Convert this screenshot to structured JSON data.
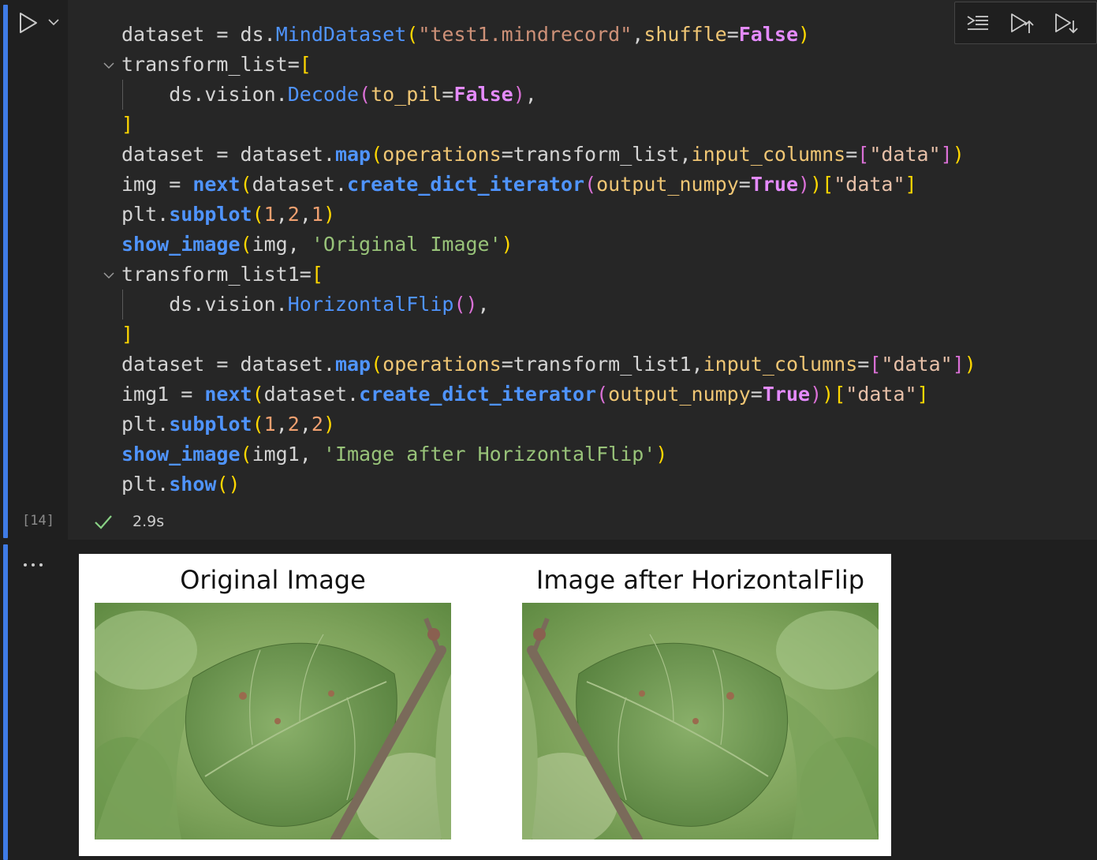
{
  "cell": {
    "execution_count": "[14]",
    "duration": "2.9s",
    "code_lines": [
      [
        [
          "t-var",
          "dataset "
        ],
        [
          "t-op",
          "= "
        ],
        [
          "t-var",
          "ds."
        ],
        [
          "t-cls",
          "MindDataset"
        ],
        [
          "t-br1",
          "("
        ],
        [
          "t-str",
          "\"test1.mindrecord\""
        ],
        [
          "t-op",
          ","
        ],
        [
          "t-prm",
          "shuffle"
        ],
        [
          "t-op",
          "="
        ],
        [
          "t-kw",
          "False"
        ],
        [
          "t-br1",
          ")"
        ]
      ],
      [
        [
          "t-var",
          "transform_list"
        ],
        [
          "t-op",
          "="
        ],
        [
          "t-br1",
          "["
        ]
      ],
      [
        [
          "t-var",
          "    ds.vision."
        ],
        [
          "t-cls",
          "Decode"
        ],
        [
          "t-br2",
          "("
        ],
        [
          "t-prm",
          "to_pil"
        ],
        [
          "t-op",
          "="
        ],
        [
          "t-kw",
          "False"
        ],
        [
          "t-br2",
          ")"
        ],
        [
          "t-op",
          ","
        ]
      ],
      [
        [
          "t-br1",
          "]"
        ]
      ],
      [
        [
          "t-var",
          "dataset "
        ],
        [
          "t-op",
          "= "
        ],
        [
          "t-var",
          "dataset."
        ],
        [
          "t-fn",
          "map"
        ],
        [
          "t-br1",
          "("
        ],
        [
          "t-prm",
          "operations"
        ],
        [
          "t-op",
          "="
        ],
        [
          "t-var",
          "transform_list"
        ],
        [
          "t-op",
          ","
        ],
        [
          "t-prm",
          "input_columns"
        ],
        [
          "t-op",
          "="
        ],
        [
          "t-br2",
          "["
        ],
        [
          "t-str2",
          "\"data\""
        ],
        [
          "t-br2",
          "]"
        ],
        [
          "t-br1",
          ")"
        ]
      ],
      [
        [
          "t-var",
          "img "
        ],
        [
          "t-op",
          "= "
        ],
        [
          "t-fn",
          "next"
        ],
        [
          "t-br1",
          "("
        ],
        [
          "t-var",
          "dataset."
        ],
        [
          "t-fn",
          "create_dict_iterator"
        ],
        [
          "t-br2",
          "("
        ],
        [
          "t-prm",
          "output_numpy"
        ],
        [
          "t-op",
          "="
        ],
        [
          "t-kw",
          "True"
        ],
        [
          "t-br2",
          ")"
        ],
        [
          "t-br1",
          ")"
        ],
        [
          "t-br1",
          "["
        ],
        [
          "t-str2",
          "\"data\""
        ],
        [
          "t-br1",
          "]"
        ]
      ],
      [
        [
          "t-var",
          "plt."
        ],
        [
          "t-fn",
          "subplot"
        ],
        [
          "t-br1",
          "("
        ],
        [
          "t-num",
          "1"
        ],
        [
          "t-op",
          ","
        ],
        [
          "t-num",
          "2"
        ],
        [
          "t-op",
          ","
        ],
        [
          "t-num",
          "1"
        ],
        [
          "t-br1",
          ")"
        ]
      ],
      [
        [
          "t-fn",
          "show_image"
        ],
        [
          "t-br1",
          "("
        ],
        [
          "t-var",
          "img"
        ],
        [
          "t-op",
          ", "
        ],
        [
          "t-strg",
          "'Original Image'"
        ],
        [
          "t-br1",
          ")"
        ]
      ],
      [
        [
          "t-var",
          "transform_list1"
        ],
        [
          "t-op",
          "="
        ],
        [
          "t-br1",
          "["
        ]
      ],
      [
        [
          "t-var",
          "    ds.vision."
        ],
        [
          "t-cls",
          "HorizontalFlip"
        ],
        [
          "t-br2",
          "()"
        ],
        [
          "t-op",
          ","
        ]
      ],
      [
        [
          "t-br1",
          "]"
        ]
      ],
      [
        [
          "t-var",
          "dataset "
        ],
        [
          "t-op",
          "= "
        ],
        [
          "t-var",
          "dataset."
        ],
        [
          "t-fn",
          "map"
        ],
        [
          "t-br1",
          "("
        ],
        [
          "t-prm",
          "operations"
        ],
        [
          "t-op",
          "="
        ],
        [
          "t-var",
          "transform_list1"
        ],
        [
          "t-op",
          ","
        ],
        [
          "t-prm",
          "input_columns"
        ],
        [
          "t-op",
          "="
        ],
        [
          "t-br2",
          "["
        ],
        [
          "t-str2",
          "\"data\""
        ],
        [
          "t-br2",
          "]"
        ],
        [
          "t-br1",
          ")"
        ]
      ],
      [
        [
          "t-var",
          "img1 "
        ],
        [
          "t-op",
          "= "
        ],
        [
          "t-fn",
          "next"
        ],
        [
          "t-br1",
          "("
        ],
        [
          "t-var",
          "dataset."
        ],
        [
          "t-fn",
          "create_dict_iterator"
        ],
        [
          "t-br2",
          "("
        ],
        [
          "t-prm",
          "output_numpy"
        ],
        [
          "t-op",
          "="
        ],
        [
          "t-kw",
          "True"
        ],
        [
          "t-br2",
          ")"
        ],
        [
          "t-br1",
          ")"
        ],
        [
          "t-br1",
          "["
        ],
        [
          "t-str2",
          "\"data\""
        ],
        [
          "t-br1",
          "]"
        ]
      ],
      [
        [
          "t-var",
          "plt."
        ],
        [
          "t-fn",
          "subplot"
        ],
        [
          "t-br1",
          "("
        ],
        [
          "t-num",
          "1"
        ],
        [
          "t-op",
          ","
        ],
        [
          "t-num",
          "2"
        ],
        [
          "t-op",
          ","
        ],
        [
          "t-num",
          "2"
        ],
        [
          "t-br1",
          ")"
        ]
      ],
      [
        [
          "t-fn",
          "show_image"
        ],
        [
          "t-br1",
          "("
        ],
        [
          "t-var",
          "img1"
        ],
        [
          "t-op",
          ", "
        ],
        [
          "t-strg",
          "'Image after HorizontalFlip'"
        ],
        [
          "t-br1",
          ")"
        ]
      ],
      [
        [
          "t-var",
          "plt."
        ],
        [
          "t-fn",
          "show"
        ],
        [
          "t-br1",
          "()"
        ]
      ]
    ],
    "folded_lines": [
      1,
      8
    ],
    "toolbar": [
      "execute-above-icon",
      "run-above-icon",
      "run-below-icon"
    ]
  },
  "output": {
    "more_label": "...",
    "figure": {
      "left_title": "Original Image",
      "right_title": "Image after HorizontalFlip"
    }
  },
  "colors": {
    "cell_accent": "#3f7be6",
    "success": "#89d185"
  }
}
